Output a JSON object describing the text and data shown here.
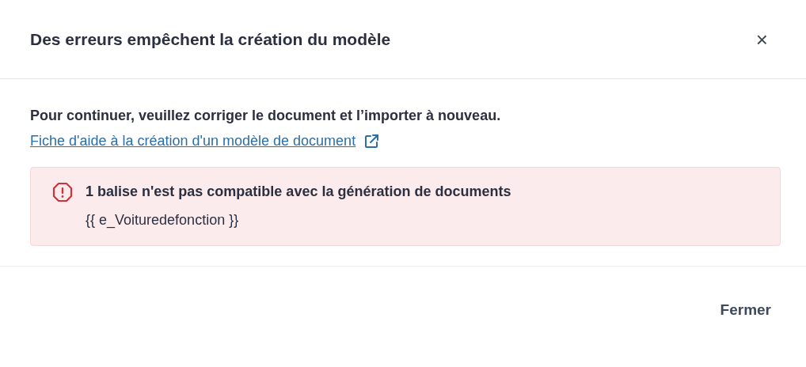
{
  "dialog": {
    "title": "Des erreurs empêchent la création du modèle",
    "close": "×"
  },
  "body": {
    "message": "Pour continuer, veuillez corriger le document et l’importer à nouveau.",
    "help_link": "Fiche d'aide à la création d'un modèle de document"
  },
  "errors": [
    {
      "kind": "error",
      "title": "1 balise n'est pas compatible avec la génération de documents",
      "detail": "{{ e_Voituredefonction }}"
    }
  ],
  "buttons": [
    "Fermer"
  ]
}
